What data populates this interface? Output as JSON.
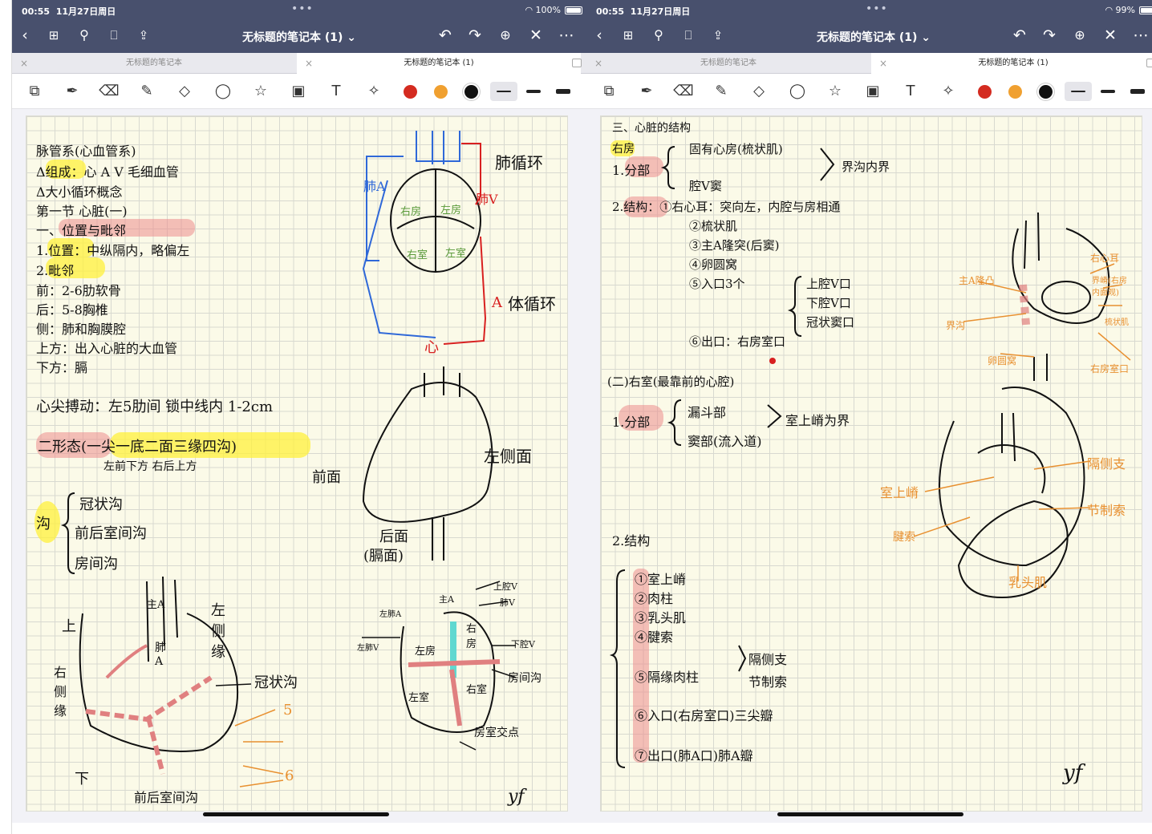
{
  "screens": [
    {
      "status": {
        "time": "00:55",
        "date": "11月27日周日",
        "battery": "100%"
      },
      "nav": {
        "title": "无标题的笔记本 (1) ⌄"
      },
      "tabs": [
        {
          "label": "无标题的笔记本"
        },
        {
          "label": "无标题的笔记本 (1)"
        }
      ],
      "note": {
        "lines": [
          "脉管系(心血管系)",
          "Δ组成：心 A V 毛细血管",
          "Δ大小循环概念",
          "第一节 心脏(一)",
          "一、位置与毗邻",
          "1.位置：中纵隔内，略偏左",
          "2.毗邻",
          "前：2-6肋软骨",
          "后：5-8胸椎",
          "侧：肺和胸膜腔",
          "上方：出入心脏的大血管",
          "下方：膈",
          "心尖搏动：左5肋间 锁中线内 1-2cm",
          "二形态(一尖一底二面三缘四沟)",
          "左前下方 右后上方",
          "冠状沟",
          "前后室间沟",
          "房间沟"
        ],
        "groove_label": "沟",
        "circ_labels": {
          "pulm_circ": "肺循环",
          "sys_circ": "体循环",
          "pa": "肺A",
          "pv": "肺V",
          "a": "A",
          "heart": "心",
          "ra": "右房",
          "la": "左房",
          "rv": "右室",
          "lv": "左室"
        },
        "heart1_labels": {
          "front": "前面",
          "left": "左侧面",
          "back": "后面",
          "back2": "(膈面)"
        },
        "heart2_labels": {
          "up": "上",
          "down": "下",
          "right_edge": "右侧缘",
          "left_edge": "左侧缘",
          "aorta": "主A",
          "pa": "肺A",
          "coronary": "冠状沟",
          "n5": "5",
          "n6": "6",
          "anterior": "前后室间沟"
        },
        "heart3_labels": {
          "svc": "上腔V",
          "pv": "肺V",
          "ivc": "下腔V",
          "aorta": "主A",
          "lpa": "左肺A",
          "lpv": "左肺V",
          "la": "左房",
          "ra": "右房",
          "lv": "左室",
          "rv": "右室",
          "ias": "房间沟",
          "cross": "房室交点"
        },
        "signature": "yf"
      }
    },
    {
      "status": {
        "time": "00:55",
        "date": "11月27日周日",
        "battery": "99%"
      },
      "nav": {
        "title": "无标题的笔记本 (1) ⌄"
      },
      "tabs": [
        {
          "label": "无标题的笔记本"
        },
        {
          "label": "无标题的笔记本 (1)"
        }
      ],
      "note": {
        "lines": [
          "三、心脏的结构",
          "右房",
          "1.分部",
          "固有心房(梳状肌)",
          "界沟内界",
          "腔V窦",
          "2.结构：①右心耳：突向左，内腔与房相通",
          "②梳状肌",
          "③主A隆突(后窦)",
          "④卵圆窝",
          "⑤入口3个",
          "上腔V口",
          "下腔V口",
          "冠状窦口",
          "⑥出口：右房室口",
          "(二)右室(最靠前的心腔)",
          "1.分部",
          "漏斗部",
          "窦部(流入道)",
          "室上嵴为界",
          "2.结构",
          "①室上嵴",
          "②肉柱",
          "③乳头肌",
          "④腱索",
          "⑤隔缘肉柱",
          "隔侧支",
          "节制索",
          "⑥入口(右房室口)三尖瓣",
          "⑦出口(肺A口)肺A瓣"
        ],
        "fig1_labels": {
          "aorta_bulge": "主A隆凸",
          "right_auricle": "右心耳",
          "sulcus": "界沟",
          "fossa": "卵圆窝",
          "sinus": "界嵴(右房内面观)",
          "pectinate": "梳状肌",
          "av": "右房室口"
        },
        "fig2_labels": {
          "supra": "室上嵴",
          "septal": "隔侧支",
          "moderator": "节制索",
          "chordae": "腱索",
          "papillary": "乳头肌"
        },
        "signature": "yf"
      }
    }
  ],
  "colors": {
    "red": "#d42b20",
    "orange": "#f0a030",
    "black": "#111111",
    "nav": "#48506d"
  }
}
